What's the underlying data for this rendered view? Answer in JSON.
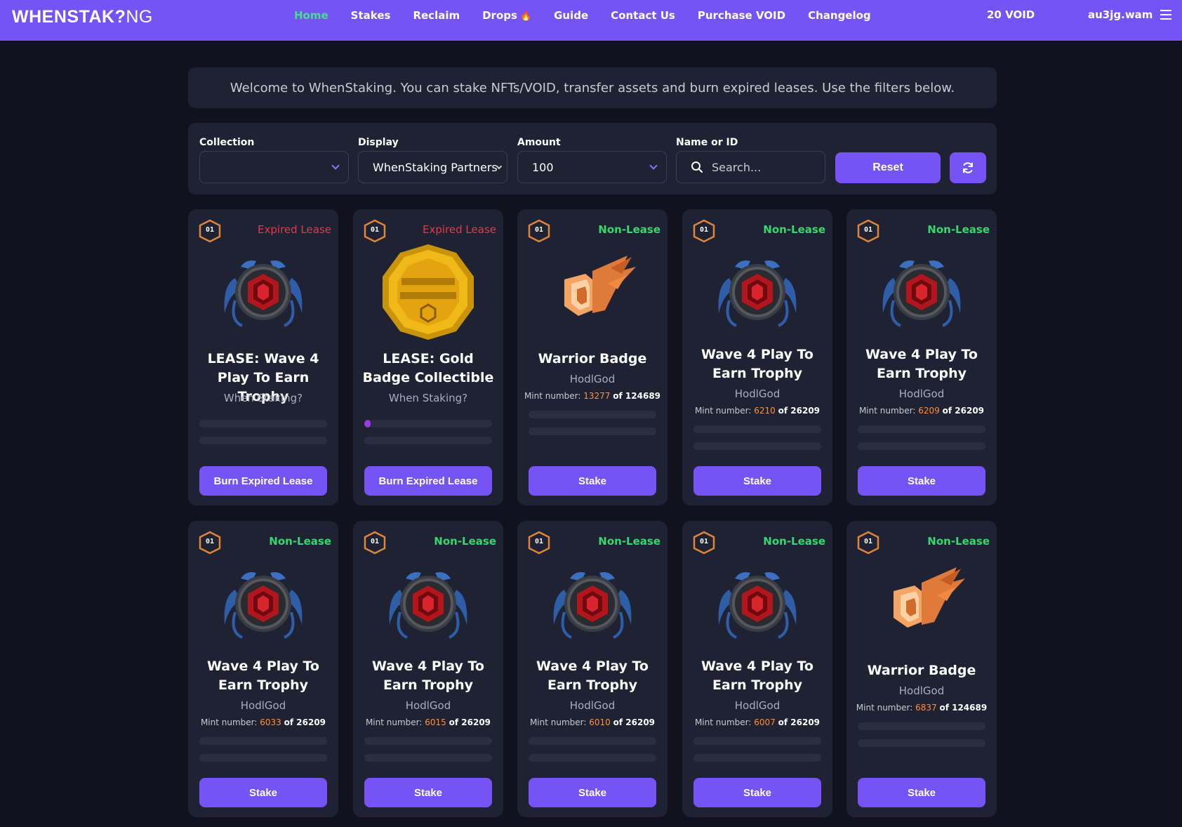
{
  "nav": {
    "logo_bold": "WHENSTAK",
    "logo_mark": "?",
    "logo_thin": "NG",
    "links": [
      {
        "label": "Home",
        "active": true
      },
      {
        "label": "Stakes"
      },
      {
        "label": "Reclaim"
      },
      {
        "label": "Drops",
        "icon": "fire-icon"
      },
      {
        "label": "Guide"
      },
      {
        "label": "Contact Us"
      },
      {
        "label": "Purchase VOID"
      },
      {
        "label": "Changelog"
      }
    ],
    "drops_fire": "🔥",
    "balance": "20 VOID",
    "account": "au3jg.wam",
    "menu_icon": "hamburger-menu-icon"
  },
  "welcome": {
    "text": "Welcome to WhenStaking. You can stake NFTs/VOID, transfer assets and burn expired leases. Use the filters below."
  },
  "filters": {
    "collection": {
      "label": "Collection",
      "value": ""
    },
    "display": {
      "label": "Display",
      "value": "WhenStaking Partners"
    },
    "amount": {
      "label": "Amount",
      "value": "100"
    },
    "name_or_id": {
      "label": "Name or ID",
      "placeholder": "Search..."
    },
    "reset_label": "Reset",
    "refresh_icon": "refresh-icon"
  },
  "colors": {
    "accent": "#7653f5",
    "background": "#11121d",
    "card": "#1f2233",
    "expired": "#e03a4e",
    "nonlease": "#35d86e",
    "mint_number": "#ff8f3a",
    "active_nav": "#43e08a"
  },
  "cards": [
    {
      "tier": "01",
      "status": "Expired Lease",
      "status_type": "expired",
      "art": "trophy",
      "title": "LEASE: Wave 4 Play To Earn Trophy",
      "collection": "When Staking?",
      "mint_prefix": "",
      "mint_number": "",
      "mint_total": "",
      "progress": 0,
      "button": "Burn Expired Lease"
    },
    {
      "tier": "01",
      "status": "Expired Lease",
      "status_type": "expired",
      "art": "gold-badge",
      "title": "LEASE: Gold Badge Collectible",
      "collection": "When Staking?",
      "mint_prefix": "",
      "mint_number": "",
      "mint_total": "",
      "progress": 0.05,
      "button": "Burn Expired Lease"
    },
    {
      "tier": "01",
      "status": "Non-Lease",
      "status_type": "nonlease",
      "art": "warrior",
      "title": "Warrior Badge",
      "collection": "HodlGod",
      "mint_prefix": "Mint number:",
      "mint_number": "13277",
      "mint_total": "of 124689",
      "progress": 0,
      "button": "Stake"
    },
    {
      "tier": "01",
      "status": "Non-Lease",
      "status_type": "nonlease",
      "art": "trophy",
      "title": "Wave 4 Play To Earn Trophy",
      "collection": "HodlGod",
      "mint_prefix": "Mint number:",
      "mint_number": "6210",
      "mint_total": "of 26209",
      "progress": 0,
      "button": "Stake"
    },
    {
      "tier": "01",
      "status": "Non-Lease",
      "status_type": "nonlease",
      "art": "trophy",
      "title": "Wave 4 Play To Earn Trophy",
      "collection": "HodlGod",
      "mint_prefix": "Mint number:",
      "mint_number": "6209",
      "mint_total": "of 26209",
      "progress": 0,
      "button": "Stake"
    },
    {
      "tier": "01",
      "status": "Non-Lease",
      "status_type": "nonlease",
      "art": "trophy",
      "title": "Wave 4 Play To Earn Trophy",
      "collection": "HodlGod",
      "mint_prefix": "Mint number:",
      "mint_number": "6033",
      "mint_total": "of 26209",
      "progress": 0,
      "button": "Stake"
    },
    {
      "tier": "01",
      "status": "Non-Lease",
      "status_type": "nonlease",
      "art": "trophy",
      "title": "Wave 4 Play To Earn Trophy",
      "collection": "HodlGod",
      "mint_prefix": "Mint number:",
      "mint_number": "6015",
      "mint_total": "of 26209",
      "progress": 0,
      "button": "Stake"
    },
    {
      "tier": "01",
      "status": "Non-Lease",
      "status_type": "nonlease",
      "art": "trophy",
      "title": "Wave 4 Play To Earn Trophy",
      "collection": "HodlGod",
      "mint_prefix": "Mint number:",
      "mint_number": "6010",
      "mint_total": "of 26209",
      "progress": 0,
      "button": "Stake"
    },
    {
      "tier": "01",
      "status": "Non-Lease",
      "status_type": "nonlease",
      "art": "trophy",
      "title": "Wave 4 Play To Earn Trophy",
      "collection": "HodlGod",
      "mint_prefix": "Mint number:",
      "mint_number": "6007",
      "mint_total": "of 26209",
      "progress": 0,
      "button": "Stake"
    },
    {
      "tier": "01",
      "status": "Non-Lease",
      "status_type": "nonlease",
      "art": "warrior",
      "title": "Warrior Badge",
      "collection": "HodlGod",
      "mint_prefix": "Mint number:",
      "mint_number": "6837",
      "mint_total": "of 124689",
      "progress": 0,
      "button": "Stake"
    }
  ]
}
